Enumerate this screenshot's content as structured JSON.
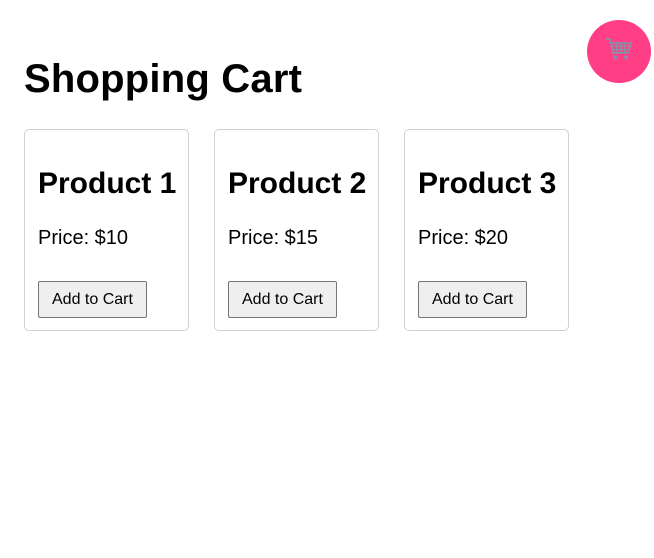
{
  "page": {
    "title": "Shopping Cart"
  },
  "cart_button": {
    "icon": "shopping-cart-icon",
    "color": "#ff3e85"
  },
  "products": [
    {
      "name": "Product 1",
      "price": "Price: $10",
      "button_label": "Add to Cart"
    },
    {
      "name": "Product 2",
      "price": "Price: $15",
      "button_label": "Add to Cart"
    },
    {
      "name": "Product 3",
      "price": "Price: $20",
      "button_label": "Add to Cart"
    }
  ]
}
